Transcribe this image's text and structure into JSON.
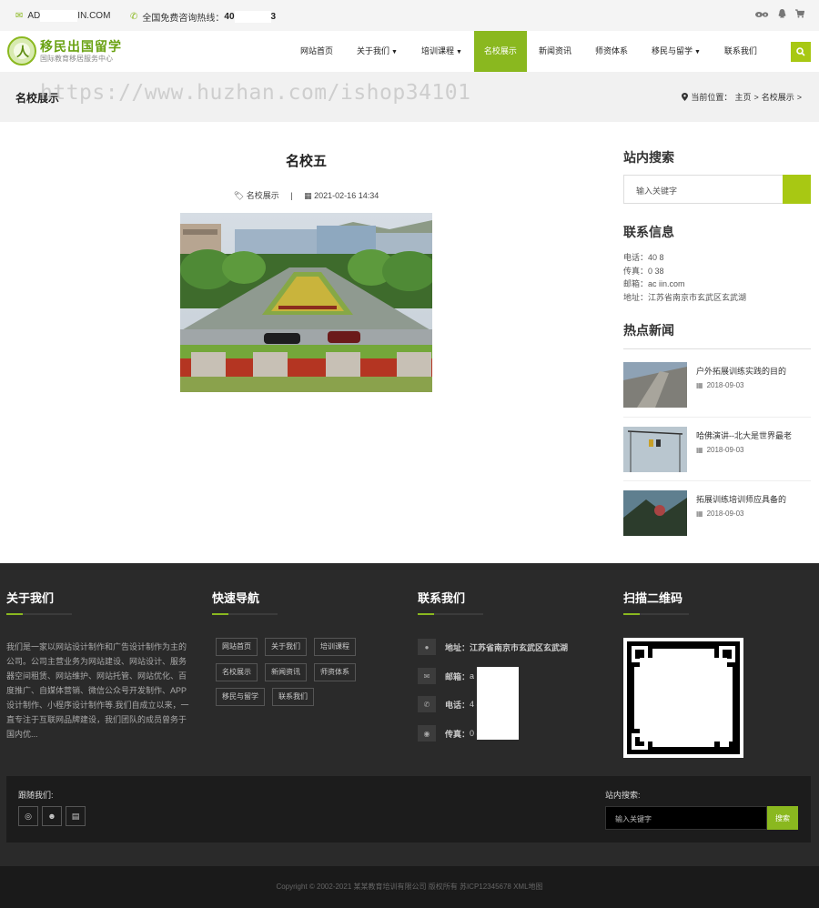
{
  "topbar": {
    "email_prefix": "AD",
    "email_suffix": "IN.COM",
    "phone_label": "全国免费咨询热线：",
    "phone_prefix": "40",
    "phone_suffix": "3"
  },
  "header": {
    "logo_title": "移民出国留学",
    "logo_subtitle": "国际教育移居服务中心",
    "nav": [
      {
        "label": "网站首页"
      },
      {
        "label": "关于我们"
      },
      {
        "label": "培训课程"
      },
      {
        "label": "名校展示"
      },
      {
        "label": "新闻资讯"
      },
      {
        "label": "师资体系"
      },
      {
        "label": "移民与留学"
      },
      {
        "label": "联系我们"
      }
    ]
  },
  "crumbs": {
    "section_title": "名校展示",
    "watermark": "https://www.huzhan.com/ishop34101",
    "location_label": "当前位置：",
    "home": "主页",
    "current": "名校展示"
  },
  "article": {
    "title": "名校五",
    "category": "名校展示",
    "sep": "|",
    "datetime": "2021-02-16 14:34"
  },
  "sidebar": {
    "search_title": "站内搜索",
    "search_placeholder": "输入关键字",
    "contact_title": "联系信息",
    "contact_lines": [
      "电话：40              8",
      "传真：0              38",
      "邮箱：ac              iin.com",
      "地址：江苏省南京市玄武区玄武湖"
    ],
    "news_title": "热点新闻",
    "news": [
      {
        "title": "户外拓展训练实践的目的",
        "date": "2018-09-03"
      },
      {
        "title": "哈佛演讲--北大是世界最老",
        "date": "2018-09-03"
      },
      {
        "title": "拓展训练培训师应具备的",
        "date": "2018-09-03"
      }
    ]
  },
  "footer": {
    "about_title": "关于我们",
    "about_text": "我们是一家以网站设计制作和广告设计制作为主的公司。公司主营业务为网站建设、网站设计、服务器空间租赁、网站维护、网站托管、网站优化、百度推广、自媒体营销、微信公众号开发制作、APP设计制作、小程序设计制作等.我们自成立以来，一直专注于互联网品牌建设，我们团队的成员曾务于国内优...",
    "nav_title": "快速导航",
    "nav_tags": [
      "网站首页",
      "关于我们",
      "培训课程",
      "名校展示",
      "新闻资讯",
      "师资体系",
      "移民与留学",
      "联系我们"
    ],
    "contact_title": "联系我们",
    "contact": [
      {
        "label": "地址：",
        "value": "江苏省南京市玄武区玄武湖"
      },
      {
        "label": "邮箱：",
        "value": "a                  hin.com"
      },
      {
        "label": "电话：",
        "value": "4                  88"
      },
      {
        "label": "传真：",
        "value": "0                  88"
      }
    ],
    "qr_title": "扫描二维码",
    "follow_label": "跟随我们:",
    "search_label": "站内搜索:",
    "search_placeholder": "输入关键字",
    "search_button": "搜索",
    "copyright": "Copyright © 2002-2021 某某教育培训有限公司 版权所有 苏ICP12345678 XML地图"
  },
  "colors": {
    "accent": "#8ab81f",
    "footer_bg": "#2a2a2a",
    "band_bg": "#f1f1f1"
  }
}
